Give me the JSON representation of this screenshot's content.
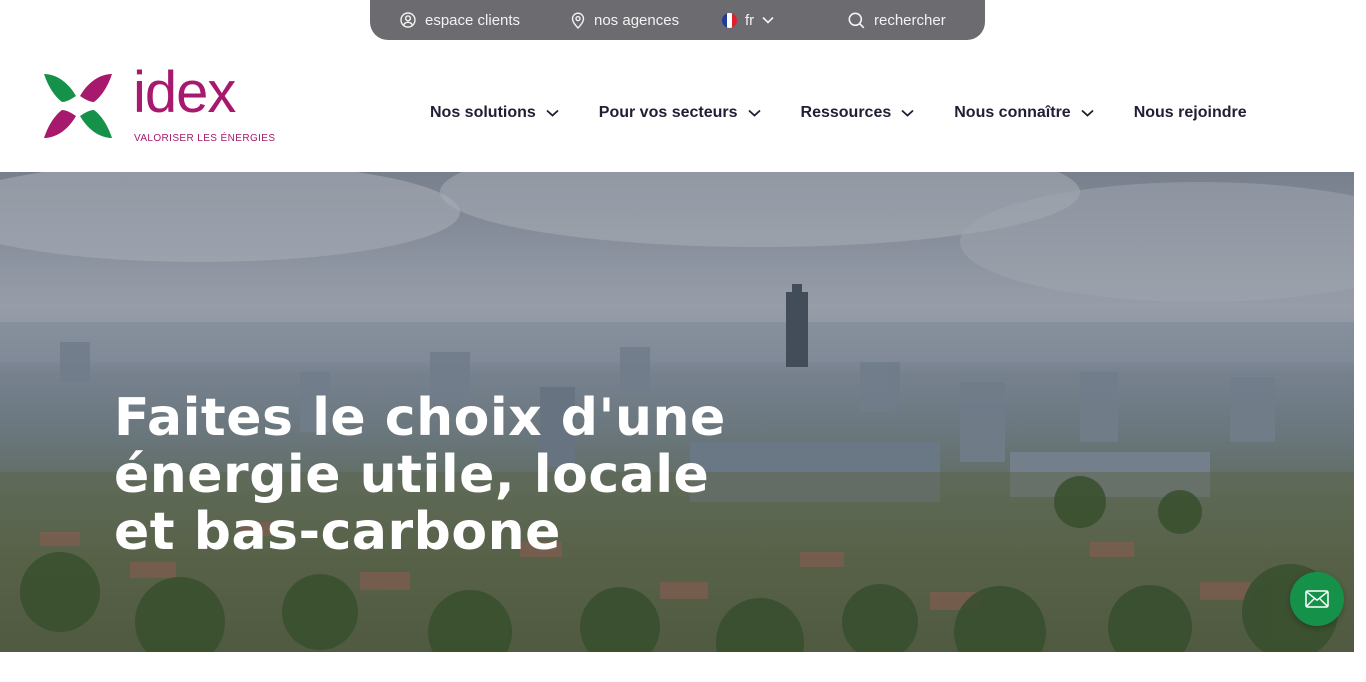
{
  "utility_bar": {
    "espace_clients": "espace clients",
    "nos_agences": "nos agences",
    "language": "fr",
    "search": "rechercher"
  },
  "logo": {
    "wordmark": "idex",
    "tagline": "VALORISER LES ÉNERGIES"
  },
  "nav": [
    {
      "label": "Nos solutions",
      "has_dropdown": true
    },
    {
      "label": "Pour vos secteurs",
      "has_dropdown": true
    },
    {
      "label": "Ressources",
      "has_dropdown": true
    },
    {
      "label": "Nous connaître",
      "has_dropdown": true
    },
    {
      "label": "Nous rejoindre",
      "has_dropdown": false
    }
  ],
  "hero": {
    "title": "Faites le choix d'une\nénergie utile, locale\net bas-carbone"
  },
  "colors": {
    "brand_magenta": "#a6196d",
    "brand_green": "#16914a",
    "utility_bar": "#6b6b70",
    "nav_text": "#1f1f33"
  },
  "icons": {
    "espace_clients": "user-circle-icon",
    "nos_agences": "map-pin-icon",
    "language": "french-flag-icon",
    "search": "search-icon",
    "contact": "envelope-icon"
  }
}
